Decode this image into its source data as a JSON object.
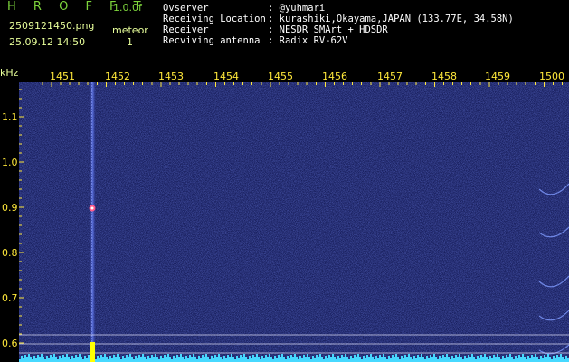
{
  "header": {
    "brand": "H R O F F T",
    "version": "1.0.0f",
    "filename": "2509121450.png",
    "datetime": "25.09.12 14:50",
    "meteor_label": "meteor",
    "meteor_count": "1",
    "info": [
      {
        "label": "Ovserver",
        "value": ": @yuhmari"
      },
      {
        "label": "Receiving Location",
        "value": ": kurashiki,Okayama,JAPAN (133.77E, 34.58N)"
      },
      {
        "label": "Receiver",
        "value": ": NESDR SMArt + HDSDR"
      },
      {
        "label": "Recviving antenna",
        "value": ": Radix RV-62V"
      }
    ]
  },
  "chart_data": {
    "type": "heatmap",
    "description_units": {
      "x": "time (minutes, hour 14)",
      "y": "kHz"
    },
    "ylabel": "kHz",
    "x_ticks": [
      "1451",
      "1452",
      "1453",
      "1454",
      "1455",
      "1456",
      "1457",
      "1458",
      "1459",
      "1500"
    ],
    "y_ticks": [
      "1.1",
      "1.0",
      "0.9",
      "0.8",
      "0.7",
      "0.6"
    ],
    "ylim": [
      0.58,
      1.18
    ],
    "meteor_events": [
      {
        "time": "14:51:50",
        "freq_khz": 0.9,
        "type": "echo"
      }
    ]
  },
  "colors": {
    "background": "#141a55",
    "tick_labels": "#ffe83a",
    "header_text": "#e8ff9a",
    "brand": "#7dd43c",
    "meteor": "#ffff00"
  }
}
